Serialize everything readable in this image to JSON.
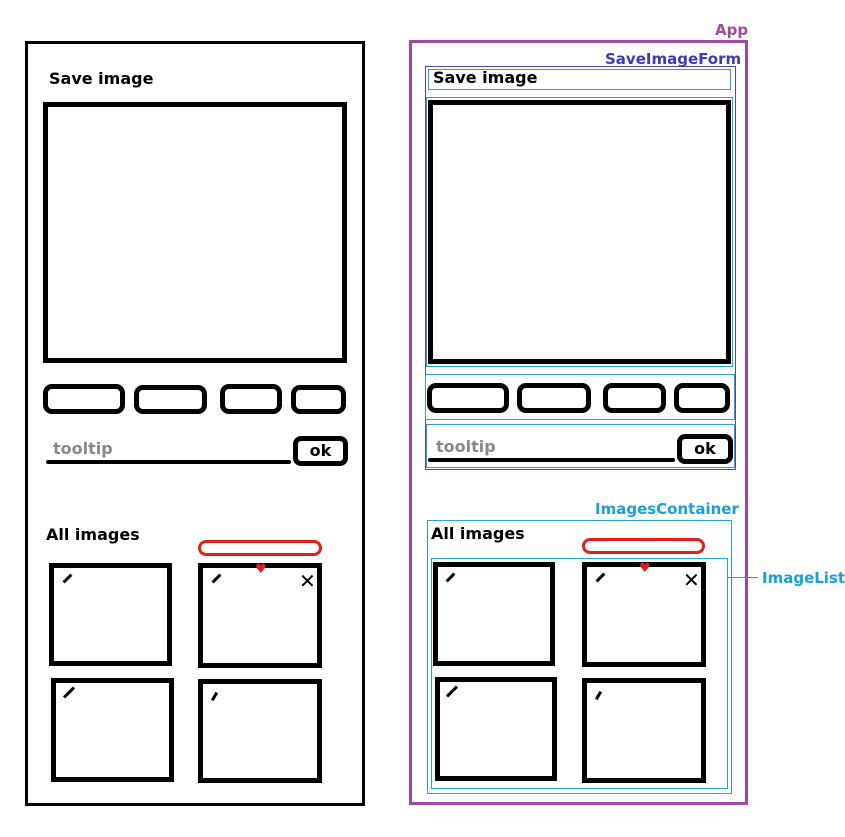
{
  "wireframe": {
    "save_title": "Save image",
    "tooltip_placeholder": "tooltip",
    "ok_label": "ok",
    "all_images_title": "All images"
  },
  "annotated": {
    "save_title": "Save image",
    "tooltip_placeholder": "tooltip",
    "ok_label": "ok",
    "all_images_title": "All images"
  },
  "labels": {
    "app": "App",
    "save_image_form": "SaveImageForm",
    "images_container": "ImagesContainer",
    "image_list": "ImageList"
  },
  "icons": {
    "edit": "pencil-icon",
    "delete": "close-icon",
    "like": "heart-icon"
  },
  "colors": {
    "app_box": "#a04aa8",
    "form_box": "#3a3ab8",
    "container_box": "#1a9fd8",
    "highlight": "#e02020"
  }
}
